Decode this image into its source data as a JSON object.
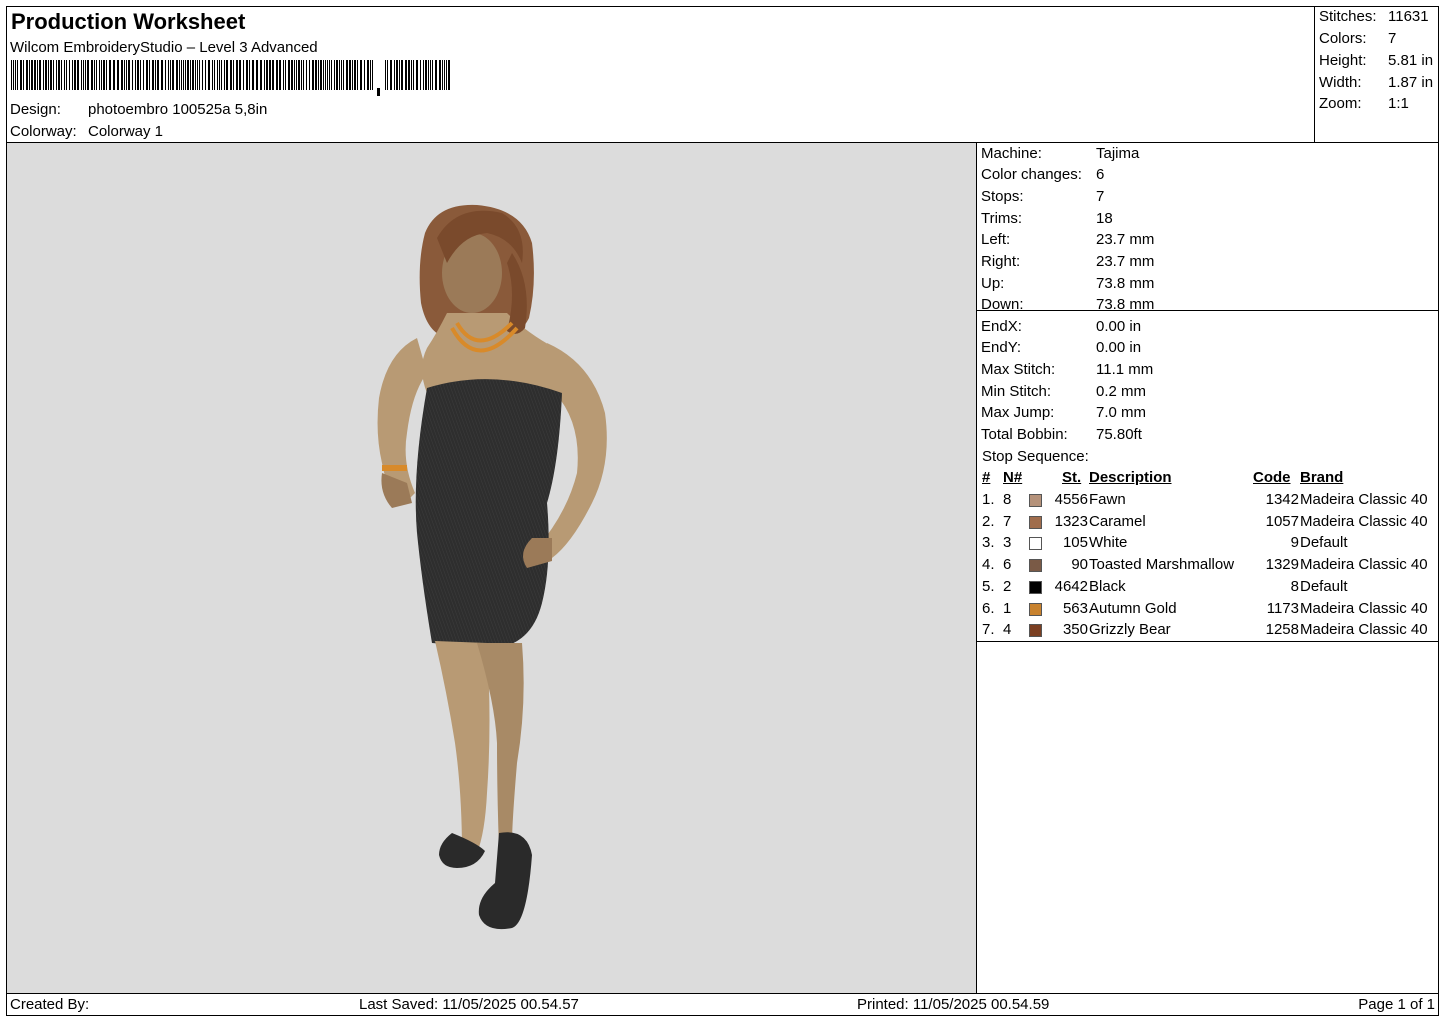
{
  "header": {
    "title": "Production Worksheet",
    "software": "Wilcom EmbroideryStudio – Level 3 Advanced",
    "design_label": "Design:",
    "design_value": "photoembro 100525a 5,8in",
    "colorway_label": "Colorway:",
    "colorway_value": "Colorway 1"
  },
  "summary": [
    {
      "label": "Stitches:",
      "value": "11631"
    },
    {
      "label": "Colors:",
      "value": "7"
    },
    {
      "label": "Height:",
      "value": "5.81 in"
    },
    {
      "label": "Width:",
      "value": "1.87 in"
    },
    {
      "label": "Zoom:",
      "value": "1:1"
    }
  ],
  "machine_info": [
    {
      "label": "Machine:",
      "value": "Tajima"
    },
    {
      "label": "Color changes:",
      "value": "6"
    },
    {
      "label": "Stops:",
      "value": "7"
    },
    {
      "label": "Trims:",
      "value": "18"
    },
    {
      "label": "Left:",
      "value": "23.7 mm"
    },
    {
      "label": "Right:",
      "value": "23.7 mm"
    },
    {
      "label": "Up:",
      "value": "73.8 mm"
    },
    {
      "label": "Down:",
      "value": "73.8 mm"
    },
    {
      "label": "EndX:",
      "value": "0.00 in"
    },
    {
      "label": "EndY:",
      "value": "0.00 in"
    },
    {
      "label": "Max Stitch:",
      "value": "11.1 mm"
    },
    {
      "label": "Min Stitch:",
      "value": "0.2 mm"
    },
    {
      "label": "Max Jump:",
      "value": "7.0 mm"
    },
    {
      "label": "Total Bobbin:",
      "value": "75.80ft"
    }
  ],
  "stop_sequence": {
    "title": "Stop Sequence:",
    "columns": {
      "num": "#",
      "n": "N#",
      "st": "St.",
      "description": "Description",
      "code": "Code",
      "brand": "Brand"
    },
    "rows": [
      {
        "num": "1.",
        "n": "8",
        "color": "#b5927a",
        "st": "4556",
        "description": "Fawn",
        "code": "1342",
        "brand": "Madeira Classic 40"
      },
      {
        "num": "2.",
        "n": "7",
        "color": "#a06d4c",
        "st": "1323",
        "description": "Caramel",
        "code": "1057",
        "brand": "Madeira Classic 40"
      },
      {
        "num": "3.",
        "n": "3",
        "color": "#ffffff",
        "st": "105",
        "description": "White",
        "code": "9",
        "brand": "Default"
      },
      {
        "num": "4.",
        "n": "6",
        "color": "#7a5a46",
        "st": "90",
        "description": "Toasted Marshmallow",
        "code": "1329",
        "brand": "Madeira Classic 40"
      },
      {
        "num": "5.",
        "n": "2",
        "color": "#000000",
        "st": "4642",
        "description": "Black",
        "code": "8",
        "brand": "Default"
      },
      {
        "num": "6.",
        "n": "1",
        "color": "#c8822e",
        "st": "563",
        "description": "Autumn Gold",
        "code": "1173",
        "brand": "Madeira Classic 40"
      },
      {
        "num": "7.",
        "n": "4",
        "color": "#7b3f22",
        "st": "350",
        "description": "Grizzly Bear",
        "code": "1258",
        "brand": "Madeira Classic 40"
      }
    ]
  },
  "footer": {
    "created_by": "Created By:",
    "last_saved": "Last Saved: 11/05/2025 00.54.57",
    "printed": "Printed: 11/05/2025 00.54.59",
    "page": "Page 1 of 1"
  }
}
